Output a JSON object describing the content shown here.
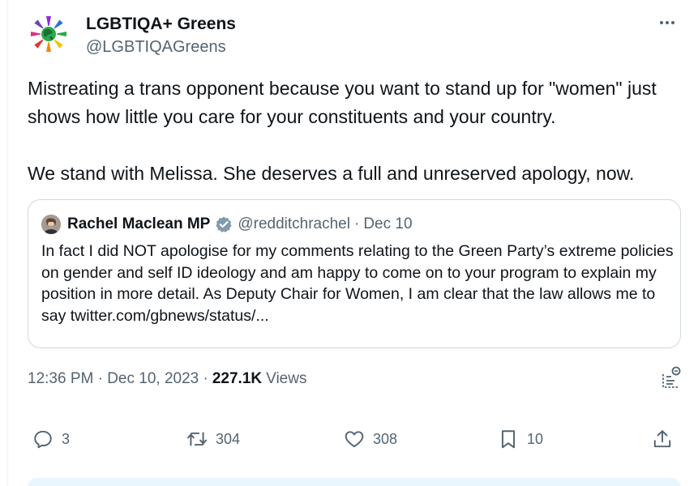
{
  "author": {
    "display_name": "LGBTIQA+ Greens",
    "handle": "@LGBTIQAGreens",
    "avatar_icon": "rainbow-globe-logo"
  },
  "tweet": {
    "text": "Mistreating a trans opponent because you want to stand up for \"women\" just shows how little you care for your constituents and your country.\n\nWe stand with Melissa. She deserves a full and unreserved apology, now."
  },
  "quoted_tweet": {
    "display_name": "Rachel Maclean MP",
    "verified_icon": "verified-badge",
    "handle": "@redditchrachel",
    "separator": "·",
    "date": "Dec 10",
    "text": "In fact I did NOT apologise for my comments relating to the Green Party’s extreme policies on gender and self ID ideology and am happy to come on to your program to explain my position in more detail. As Deputy Chair for Women, I am clear that the law allows me to say twitter.com/gbnews/status/..."
  },
  "meta": {
    "timestamp": "12:36 PM · Dec 10, 2023 ·",
    "views_count": "227.1K",
    "views_label": "Views"
  },
  "actions": {
    "replies": "3",
    "retweets": "304",
    "likes": "308",
    "bookmarks": "10"
  },
  "colors": {
    "text": "#0f1419",
    "secondary": "#536471",
    "border": "#cfd9de",
    "verified": "#829aab"
  }
}
